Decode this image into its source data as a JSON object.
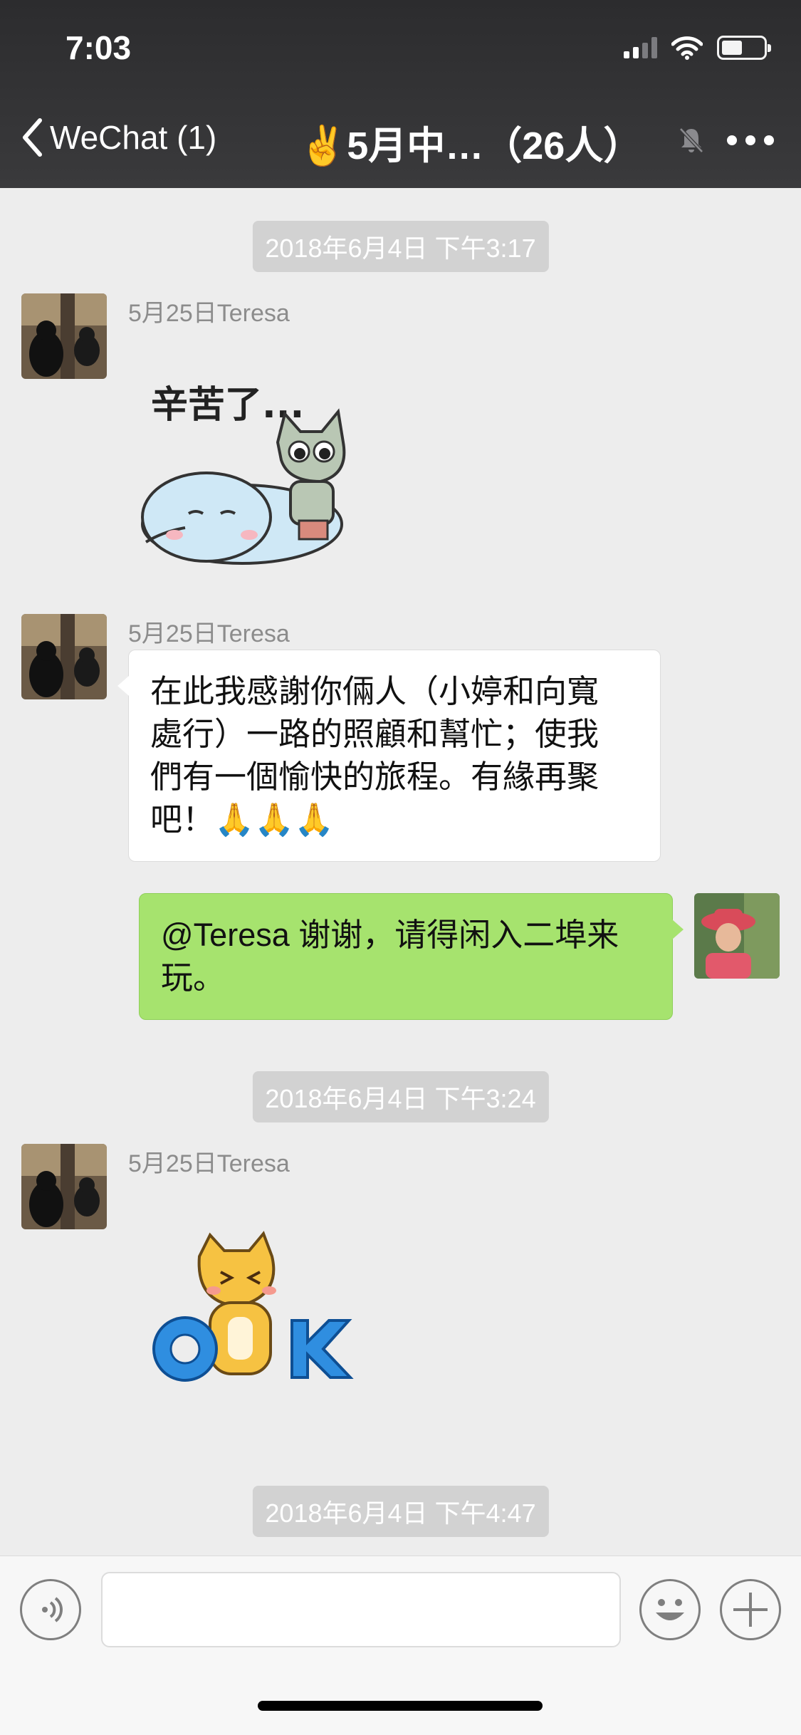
{
  "status_bar": {
    "time": "7:03"
  },
  "nav": {
    "back_label": "WeChat (1)",
    "title": "✌️5月中…（26人）"
  },
  "messages": [
    {
      "type": "timestamp",
      "text": "2018年6月4日 下午3:17"
    },
    {
      "type": "incoming_sticker",
      "sender": "5月25日Teresa",
      "sticker_text": "辛苦了..."
    },
    {
      "type": "incoming_text",
      "sender": "5月25日Teresa",
      "lines": [
        "在此我感謝你倆人（小婷和向寬",
        "處行）一路的照顧和幫忙；使我",
        "們有一個愉快的旅程。有緣再聚",
        "吧！🙏🙏🙏"
      ]
    },
    {
      "type": "outgoing_text",
      "lines": [
        "@Teresa 谢谢，请得闲入二埠来",
        "玩。"
      ]
    },
    {
      "type": "timestamp",
      "text": "2018年6月4日 下午3:24"
    },
    {
      "type": "incoming_sticker",
      "sender": "5月25日Teresa",
      "sticker_text": "OK"
    },
    {
      "type": "timestamp",
      "text": "2018年6月4日 下午4:47"
    }
  ],
  "input": {
    "value": ""
  },
  "icons": {
    "voice": "voice-icon",
    "emoji": "emoji-icon",
    "plus": "plus-icon",
    "mute": "bell-muted-icon",
    "more": "more-dots-icon",
    "back": "chevron-left-icon"
  },
  "colors": {
    "outgoing_bubble": "#a6e36e",
    "incoming_bubble": "#ffffff",
    "background": "#ededed"
  }
}
